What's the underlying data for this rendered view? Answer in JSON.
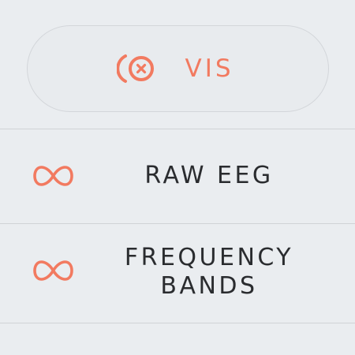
{
  "vis_button": {
    "label": "VIS",
    "icon": "sensor-off-icon"
  },
  "menu": {
    "items": [
      {
        "label_line1": "RAW EEG",
        "label_line2": "",
        "icon": "infinity-icon"
      },
      {
        "label_line1": "FREQUENCY",
        "label_line2": "BANDS",
        "icon": "infinity-icon"
      }
    ]
  },
  "colors": {
    "accent": "#f27a60",
    "text": "#2a2c2f",
    "background": "#eaedf0",
    "divider": "#cfd2d6"
  }
}
